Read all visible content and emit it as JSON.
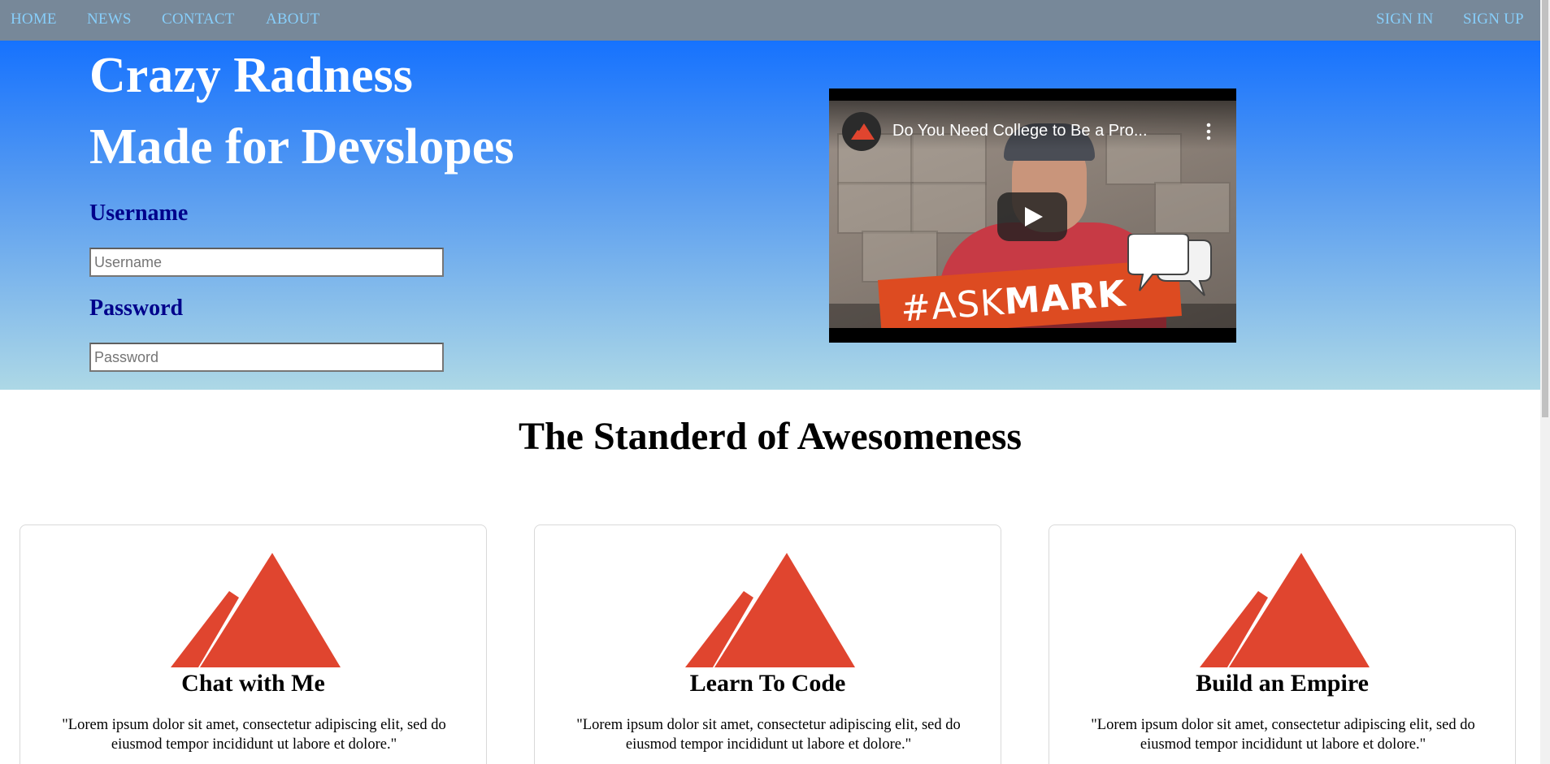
{
  "nav": {
    "left": [
      {
        "label": "HOME"
      },
      {
        "label": "NEWS"
      },
      {
        "label": "CONTACT"
      },
      {
        "label": "ABOUT"
      }
    ],
    "right": [
      {
        "label": "SIGN IN"
      },
      {
        "label": "SIGN UP"
      }
    ]
  },
  "hero": {
    "title_line1": "Crazy Radness",
    "title_line2": "Made for Devslopes",
    "username_label": "Username",
    "username_placeholder": "Username",
    "password_label": "Password",
    "password_placeholder": "Password"
  },
  "video": {
    "title": "Do You Need College to Be a Pro...",
    "thumbnail_hashtag": "#ASK",
    "thumbnail_name": "MARK"
  },
  "section": {
    "title": "The Standerd of Awesomeness"
  },
  "cards": [
    {
      "title": "Chat with Me",
      "text": "\"Lorem ipsum dolor sit amet, consectetur adipiscing elit, sed do eiusmod tempor incididunt ut labore et dolore.\""
    },
    {
      "title": "Learn To Code",
      "text": "\"Lorem ipsum dolor sit amet, consectetur adipiscing elit, sed do eiusmod tempor incididunt ut labore et dolore.\""
    },
    {
      "title": "Build an Empire",
      "text": "\"Lorem ipsum dolor sit amet, consectetur adipiscing elit, sed do eiusmod tempor incididunt ut labore et dolore.\""
    }
  ],
  "colors": {
    "navbar_bg": "#778899",
    "nav_link": "#87cefa",
    "hero_top": "#1672fe",
    "hero_bottom": "#add8e6",
    "label": "#00008b",
    "logo_red": "#e0452f",
    "askmark_orange": "#dd4b21"
  },
  "icons": {
    "card_logo": "devslopes-logo-icon",
    "video_channel": "devslopes-logo-icon",
    "video_menu": "more-vert-icon",
    "video_play": "play-icon"
  }
}
